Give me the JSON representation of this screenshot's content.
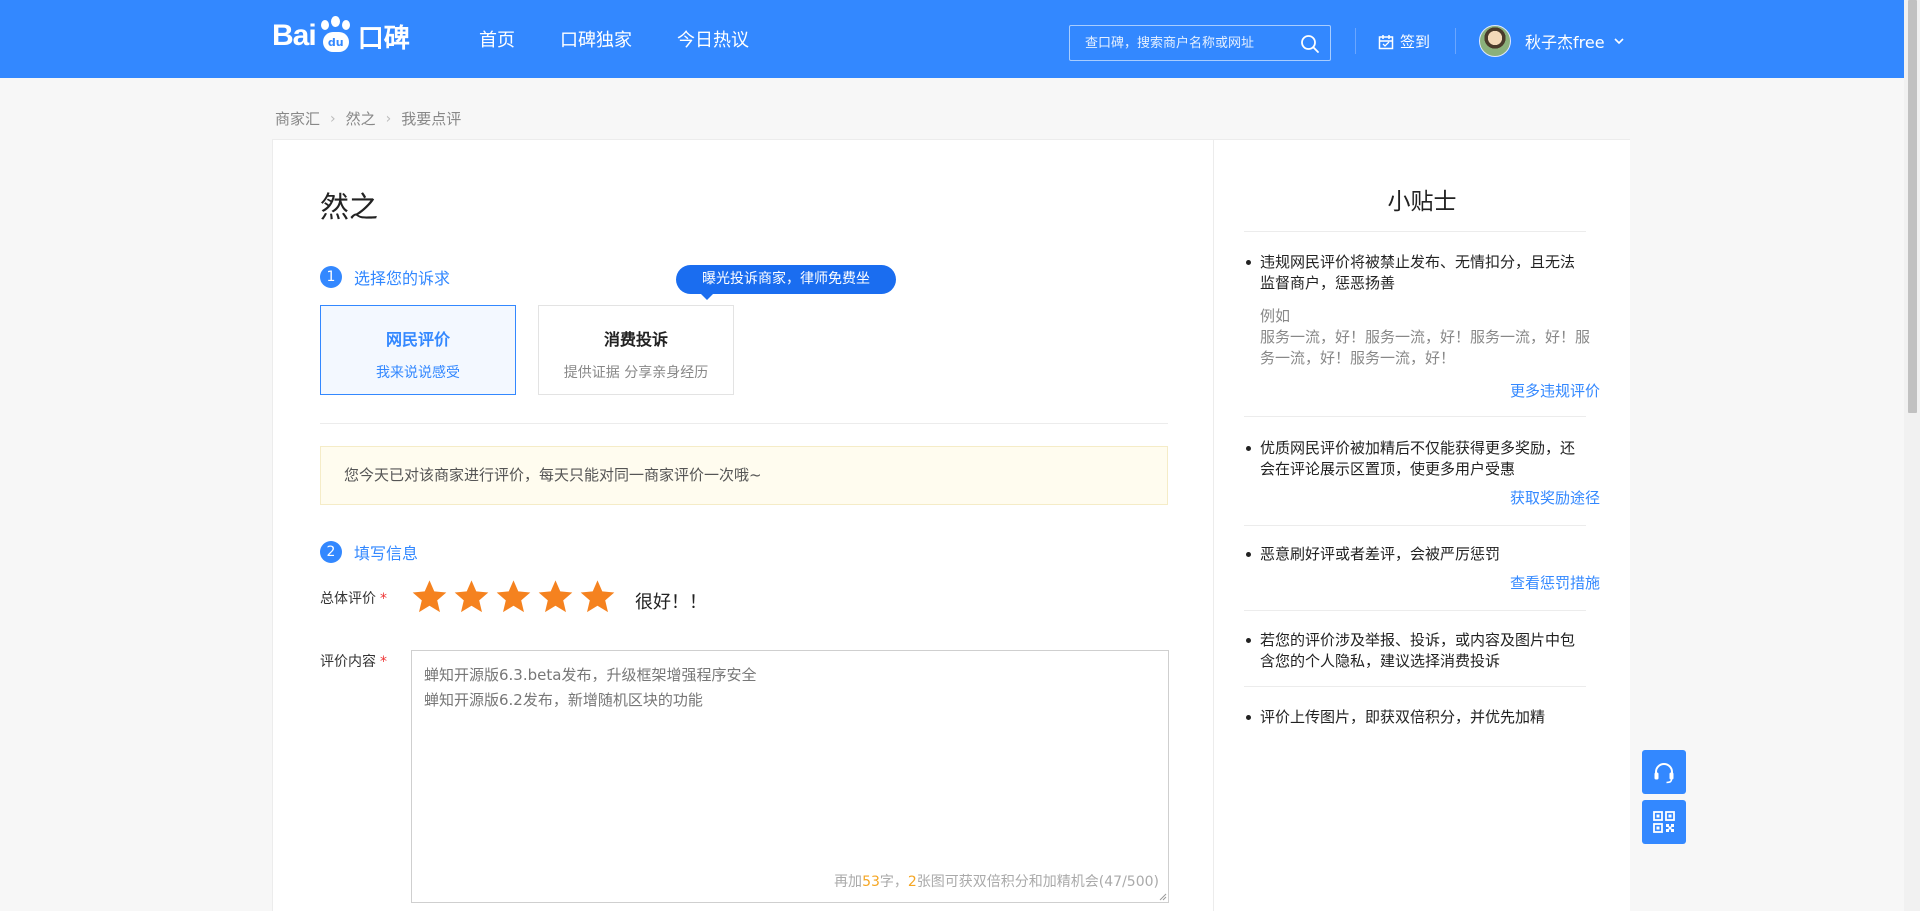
{
  "header": {
    "logo": {
      "bai": "Bai",
      "du": "du",
      "kb": "口碑"
    },
    "nav": [
      "首页",
      "口碑独家",
      "今日热议"
    ],
    "search": {
      "placeholder": "查口碑，搜索商户名称或网址"
    },
    "checkin_label": "签到",
    "user_name": "秋子杰free",
    "accent_color": "#3388ff"
  },
  "breadcrumb": [
    "商家汇",
    "然之",
    "我要点评"
  ],
  "main": {
    "merchant_name": "然之",
    "step1": {
      "num": "1",
      "label": "选择您的诉求"
    },
    "options": [
      {
        "title": "网民评价",
        "subtitle": "我来说说感受",
        "active": true
      },
      {
        "title": "消费投诉",
        "subtitle": "提供证据 分享亲身经历",
        "active": false
      }
    ],
    "bubble": "曝光投诉商家，律师免费坐",
    "notice": "您今天已对该商家进行评价，每天只能对同一商家评价一次哦~",
    "step2": {
      "num": "2",
      "label": "填写信息"
    },
    "rating": {
      "label": "总体评价",
      "required_mark": "*",
      "stars": 5,
      "max_stars": 5,
      "text": "很好！！",
      "star_color": "#f5821f"
    },
    "content": {
      "label": "评价内容",
      "required_mark": "*",
      "value": "蝉知开源版6.3.beta发布，升级框架增强程序安全\n蝉知开源版6.2发布，新增随机区块的功能",
      "counter": {
        "prefix": "再加",
        "chars": "53",
        "mid": "字，",
        "images": "2",
        "suffix": "张图可获双倍积分和加精机会(47/500)"
      }
    }
  },
  "tips": {
    "title": "小贴士",
    "items": [
      {
        "text": "违规网民评价将被禁止发布、无情扣分，且无法监督商户，惩恶扬善",
        "example_label": "例如",
        "example": "服务一流，好！服务一流，好！服务一流，好！服务一流，好！服务一流，好！",
        "link": "更多违规评价"
      },
      {
        "text": "优质网民评价被加精后不仅能获得更多奖励，还会在评论展示区置顶，使更多用户受惠",
        "link": "获取奖励途径"
      },
      {
        "text": "恶意刷好评或者差评，会被严厉惩罚",
        "link": "查看惩罚措施"
      },
      {
        "text": "若您的评价涉及举报、投诉，或内容及图片中包含您的个人隐私，建议选择消费投诉"
      },
      {
        "text": "评价上传图片，即获双倍积分，并优先加精"
      }
    ]
  },
  "float_buttons": [
    "headset-icon",
    "qrcode-icon"
  ]
}
